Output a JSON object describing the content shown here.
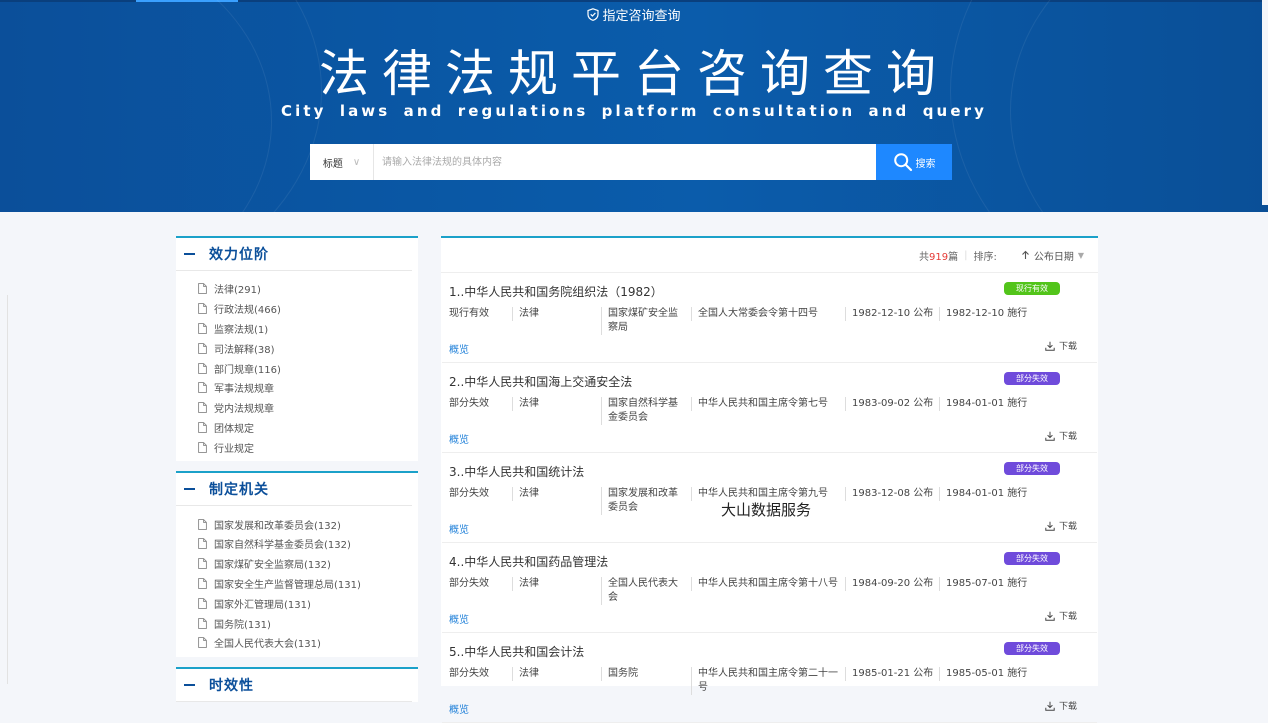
{
  "header": {
    "badge": "指定咨询查询",
    "title": "法律法规平台咨询查询",
    "subtitle": "City laws and regulations platform consultation and query"
  },
  "search": {
    "type": "标题",
    "placeholder": "请输入法律法规的具体内容",
    "button": "搜索"
  },
  "sidebar": {
    "sections": [
      {
        "title": "效力位阶",
        "items": [
          "法律(291)",
          "行政法规(466)",
          "监察法规(1)",
          "司法解释(38)",
          "部门规章(116)",
          "军事法规规章",
          "党内法规规章",
          "团体规定",
          "行业规定"
        ]
      },
      {
        "title": "制定机关",
        "items": [
          "国家发展和改革委员会(132)",
          "国家自然科学基金委员会(132)",
          "国家煤矿安全监察局(132)",
          "国家安全生产监督管理总局(131)",
          "国家外汇管理局(131)",
          "国务院(131)",
          "全国人民代表大会(131)"
        ]
      },
      {
        "title": "时效性",
        "items": []
      }
    ]
  },
  "toolbar": {
    "count_prefix": "共",
    "count": "919",
    "count_suffix": "篇",
    "sort_label": "排序:",
    "sort_value": "公布日期"
  },
  "results": [
    {
      "title": "1..中华人民共和国务院组织法（1982）",
      "status": "现行有效",
      "tag": "现行有效",
      "tag_color": "#52c41a",
      "level": "法律",
      "org_l1": "国家煤矿安全监",
      "org_l2": "察局",
      "doc_l1": "全国人大常委会令第十四号",
      "doc_l2": "",
      "published": "1982-12-10 公布",
      "effective": "1982-12-10 施行",
      "overview": "概览",
      "download": "下载"
    },
    {
      "title": "2..中华人民共和国海上交通安全法",
      "status": "部分失效",
      "tag": "部分失效",
      "tag_color": "#6f4bdb",
      "level": "法律",
      "org_l1": "国家自然科学基",
      "org_l2": "金委员会",
      "doc_l1": "中华人民共和国主席令第七号",
      "doc_l2": "",
      "published": "1983-09-02 公布",
      "effective": "1984-01-01 施行",
      "overview": "概览",
      "download": "下载"
    },
    {
      "title": "3..中华人民共和国统计法",
      "status": "部分失效",
      "tag": "部分失效",
      "tag_color": "#6f4bdb",
      "level": "法律",
      "org_l1": "国家发展和改革",
      "org_l2": "委员会",
      "doc_l1": "中华人民共和国主席令第九号",
      "doc_l2": "",
      "published": "1983-12-08 公布",
      "effective": "1984-01-01 施行",
      "overview": "概览",
      "download": "下载"
    },
    {
      "title": "4..中华人民共和国药品管理法",
      "status": "部分失效",
      "tag": "部分失效",
      "tag_color": "#6f4bdb",
      "level": "法律",
      "org_l1": "全国人民代表大",
      "org_l2": "会",
      "doc_l1": "中华人民共和国主席令第十八号",
      "doc_l2": "",
      "published": "1984-09-20 公布",
      "effective": "1985-07-01 施行",
      "overview": "概览",
      "download": "下载"
    },
    {
      "title": "5..中华人民共和国会计法",
      "status": "部分失效",
      "tag": "部分失效",
      "tag_color": "#6f4bdb",
      "level": "法律",
      "org_l1": "国务院",
      "org_l2": "",
      "doc_l1": "中华人民共和国主席令第二十一",
      "doc_l2": "号",
      "published": "1985-01-21 公布",
      "effective": "1985-05-01 施行",
      "overview": "概览",
      "download": "下载"
    }
  ],
  "watermark": "大山数据服务",
  "colors": {
    "banner": "#0b5aa8",
    "accent": "#1e88ff",
    "tag_current": "#52c41a",
    "tag_partial": "#6f4bdb",
    "panel_border": "#1ba1c9"
  }
}
